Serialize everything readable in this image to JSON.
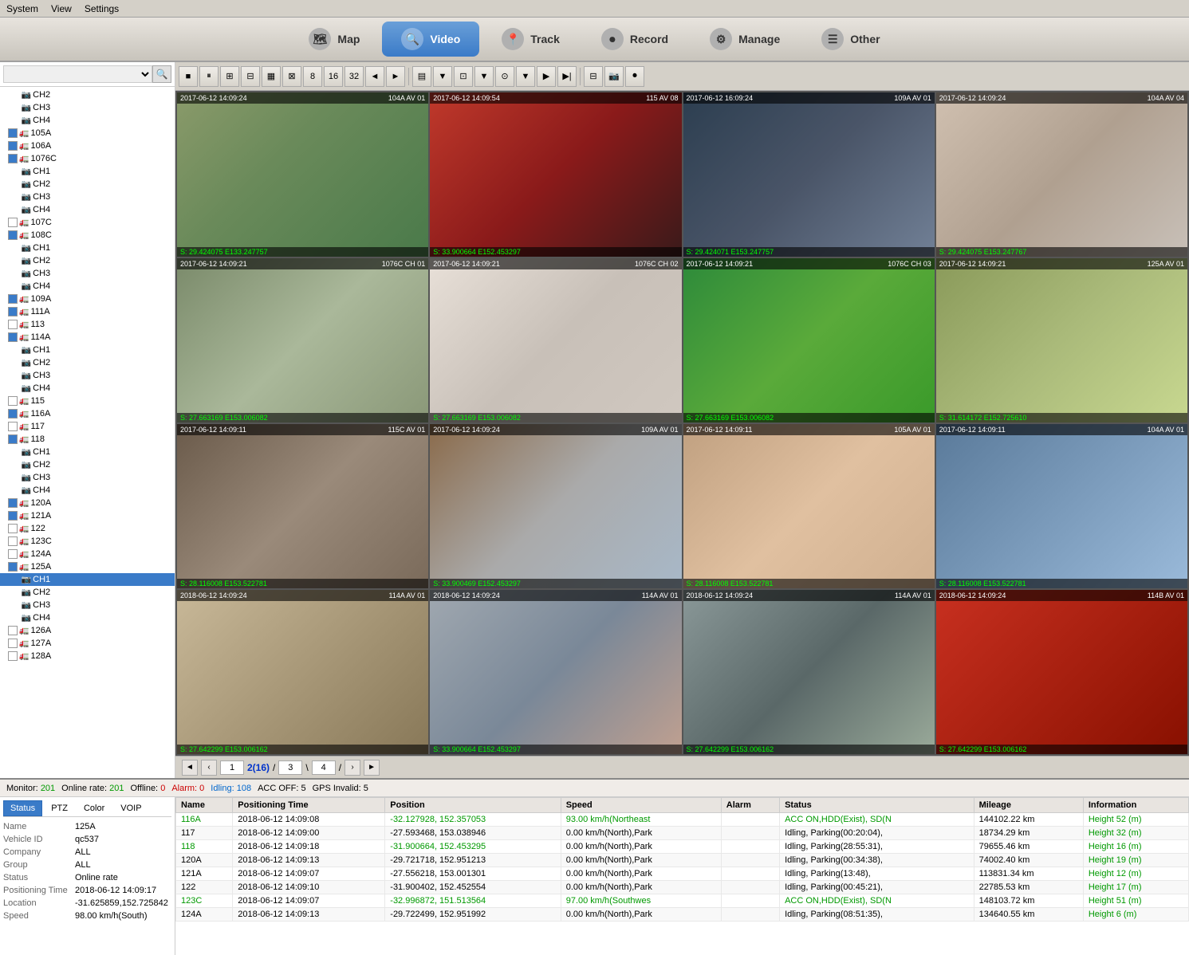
{
  "menu": {
    "system": "System",
    "view": "View",
    "settings": "Settings"
  },
  "nav": {
    "tabs": [
      {
        "id": "map",
        "label": "Map",
        "icon": "🗺",
        "active": false
      },
      {
        "id": "video",
        "label": "Video",
        "icon": "🔍",
        "active": true
      },
      {
        "id": "track",
        "label": "Track",
        "icon": "📍",
        "active": false
      },
      {
        "id": "record",
        "label": "Record",
        "icon": "⏺",
        "active": false
      },
      {
        "id": "manage",
        "label": "Manage",
        "icon": "⚙",
        "active": false
      },
      {
        "id": "other",
        "label": "Other",
        "icon": "☰",
        "active": false
      }
    ]
  },
  "sidebar": {
    "search_placeholder": "Search",
    "tree": [
      {
        "id": "ch2",
        "label": "CH2",
        "level": 2,
        "type": "channel",
        "checked": false
      },
      {
        "id": "ch3",
        "label": "CH3",
        "level": 2,
        "type": "channel",
        "checked": false
      },
      {
        "id": "ch4",
        "label": "CH4",
        "level": 2,
        "type": "channel",
        "checked": false
      },
      {
        "id": "105a",
        "label": "105A",
        "level": 1,
        "type": "vehicle",
        "checked": true
      },
      {
        "id": "106a",
        "label": "106A",
        "level": 1,
        "type": "vehicle",
        "checked": true
      },
      {
        "id": "1076c",
        "label": "1076C",
        "level": 1,
        "type": "vehicle",
        "checked": true,
        "expanded": true
      },
      {
        "id": "1076c-ch1",
        "label": "CH1",
        "level": 2,
        "type": "channel",
        "checked": false
      },
      {
        "id": "1076c-ch2",
        "label": "CH2",
        "level": 2,
        "type": "channel",
        "checked": false
      },
      {
        "id": "1076c-ch3",
        "label": "CH3",
        "level": 2,
        "type": "channel",
        "checked": false
      },
      {
        "id": "1076c-ch4",
        "label": "CH4",
        "level": 2,
        "type": "channel",
        "checked": false
      },
      {
        "id": "107c",
        "label": "107C",
        "level": 1,
        "type": "vehicle",
        "checked": false
      },
      {
        "id": "108c",
        "label": "108C",
        "level": 1,
        "type": "vehicle",
        "checked": true,
        "expanded": true
      },
      {
        "id": "108c-ch1",
        "label": "CH1",
        "level": 2,
        "type": "channel",
        "checked": false
      },
      {
        "id": "108c-ch2",
        "label": "CH2",
        "level": 2,
        "type": "channel",
        "checked": false
      },
      {
        "id": "108c-ch3",
        "label": "CH3",
        "level": 2,
        "type": "channel",
        "checked": false
      },
      {
        "id": "108c-ch4",
        "label": "CH4",
        "level": 2,
        "type": "channel",
        "checked": false
      },
      {
        "id": "109a",
        "label": "109A",
        "level": 1,
        "type": "vehicle",
        "checked": true
      },
      {
        "id": "111a",
        "label": "111A",
        "level": 1,
        "type": "vehicle",
        "checked": true
      },
      {
        "id": "113",
        "label": "113",
        "level": 1,
        "type": "vehicle",
        "checked": false
      },
      {
        "id": "114a",
        "label": "114A",
        "level": 1,
        "type": "vehicle",
        "checked": true,
        "expanded": true
      },
      {
        "id": "114a-ch1",
        "label": "CH1",
        "level": 2,
        "type": "channel",
        "checked": false
      },
      {
        "id": "114a-ch2",
        "label": "CH2",
        "level": 2,
        "type": "channel",
        "checked": false
      },
      {
        "id": "114a-ch3",
        "label": "CH3",
        "level": 2,
        "type": "channel",
        "checked": false
      },
      {
        "id": "114a-ch4",
        "label": "CH4",
        "level": 2,
        "type": "channel",
        "checked": false
      },
      {
        "id": "115",
        "label": "115",
        "level": 1,
        "type": "vehicle",
        "checked": false
      },
      {
        "id": "116a",
        "label": "116A",
        "level": 1,
        "type": "vehicle",
        "checked": true
      },
      {
        "id": "117",
        "label": "117",
        "level": 1,
        "type": "vehicle",
        "checked": false
      },
      {
        "id": "118",
        "label": "118",
        "level": 1,
        "type": "vehicle",
        "checked": true,
        "expanded": true
      },
      {
        "id": "118-ch1",
        "label": "CH1",
        "level": 2,
        "type": "channel",
        "checked": false
      },
      {
        "id": "118-ch2",
        "label": "CH2",
        "level": 2,
        "type": "channel",
        "checked": false
      },
      {
        "id": "118-ch3",
        "label": "CH3",
        "level": 2,
        "type": "channel",
        "checked": false
      },
      {
        "id": "118-ch4",
        "label": "CH4",
        "level": 2,
        "type": "channel",
        "checked": false
      },
      {
        "id": "120a",
        "label": "120A",
        "level": 1,
        "type": "vehicle",
        "checked": true
      },
      {
        "id": "121a",
        "label": "121A",
        "level": 1,
        "type": "vehicle",
        "checked": true
      },
      {
        "id": "122",
        "label": "122",
        "level": 1,
        "type": "vehicle",
        "checked": false
      },
      {
        "id": "123c",
        "label": "123C",
        "level": 1,
        "type": "vehicle",
        "checked": false
      },
      {
        "id": "124a",
        "label": "124A",
        "level": 1,
        "type": "vehicle",
        "checked": false
      },
      {
        "id": "125a",
        "label": "125A",
        "level": 1,
        "type": "vehicle",
        "checked": true,
        "expanded": true
      },
      {
        "id": "125a-ch1",
        "label": "CH1",
        "level": 2,
        "type": "channel",
        "checked": false,
        "selected": true
      },
      {
        "id": "125a-ch2",
        "label": "CH2",
        "level": 2,
        "type": "channel",
        "checked": false
      },
      {
        "id": "125a-ch3",
        "label": "CH3",
        "level": 2,
        "type": "channel",
        "checked": false
      },
      {
        "id": "125a-ch4",
        "label": "CH4",
        "level": 2,
        "type": "channel",
        "checked": false
      },
      {
        "id": "126a",
        "label": "126A",
        "level": 1,
        "type": "vehicle",
        "checked": false
      },
      {
        "id": "127a",
        "label": "127A",
        "level": 1,
        "type": "vehicle",
        "checked": false
      },
      {
        "id": "128a",
        "label": "128A",
        "level": 1,
        "type": "vehicle",
        "checked": false
      }
    ]
  },
  "video_cells": [
    {
      "id": 1,
      "timestamp": "2017-06-12 14:09:24",
      "label": "104A AV 01",
      "coords": "S: 29.424075 E133.247757"
    },
    {
      "id": 2,
      "timestamp": "2017-06-12 14:09:54",
      "label": "115 AV 08",
      "coords": "S: 33.900664 E152.453297"
    },
    {
      "id": 3,
      "timestamp": "2017-06-12 16:09:24",
      "label": "109A AV 01",
      "coords": "S: 29.424071 E153.247757"
    },
    {
      "id": 4,
      "timestamp": "2017-06-12 14:09:24",
      "label": "104A AV 04",
      "coords": "S: 29.424075 E153.247767"
    },
    {
      "id": 5,
      "timestamp": "2017-06-12 14:09:21",
      "label": "1076C CH 01",
      "coords": "S: 27.663169 E153.006082"
    },
    {
      "id": 6,
      "timestamp": "2017-06-12 14:09:21",
      "label": "1076C CH 02",
      "coords": "S: 27.663169 E153.006082"
    },
    {
      "id": 7,
      "timestamp": "2017-06-12 14:09:21",
      "label": "1076C CH 03",
      "coords": "S: 27.663169 E153.006082"
    },
    {
      "id": 8,
      "timestamp": "2017-06-12 14:09:21",
      "label": "125A AV 01",
      "coords": "S: 31.614172 E152.725610"
    },
    {
      "id": 9,
      "timestamp": "2017-06-12 14:09:11",
      "label": "115C AV 01",
      "coords": "S: 28.116008 E153.522781"
    },
    {
      "id": 10,
      "timestamp": "2017-06-12 14:09:24",
      "label": "109A AV 01",
      "coords": "S: 33.900469 E152.453297"
    },
    {
      "id": 11,
      "timestamp": "2017-06-12 14:09:11",
      "label": "105A AV 01",
      "coords": "S: 28.116008 E153.522781"
    },
    {
      "id": 12,
      "timestamp": "2017-06-12 14:09:11",
      "label": "104A AV 01",
      "coords": "S: 28.116008 E153.522781"
    },
    {
      "id": 13,
      "timestamp": "2018-06-12 14:09:24",
      "label": "114A AV 01",
      "coords": "S: 27.642299 E153.006162"
    },
    {
      "id": 14,
      "timestamp": "2018-06-12 14:09:24",
      "label": "114A AV 01",
      "coords": "S: 33.900664 E152.453297"
    },
    {
      "id": 15,
      "timestamp": "2018-06-12 14:09:24",
      "label": "114A AV 01",
      "coords": "S: 27.642299 E153.006162"
    },
    {
      "id": 16,
      "timestamp": "2018-06-12 14:09:24",
      "label": "114B AV 01",
      "coords": "S: 27.642299 E153.006162"
    }
  ],
  "pagination": {
    "prev_label": "◄",
    "next_label": "►",
    "first_label": "◄◄",
    "last_label": "►►",
    "current_page": "2",
    "total_pages": "16",
    "page_label": "2(16)",
    "jump_to": "3",
    "end_page": "4"
  },
  "status_bar": {
    "monitor_label": "Monitor:",
    "monitor_value": "201",
    "online_label": "Online rate:",
    "online_value": "201",
    "offline_label": "Offline:",
    "offline_value": "0",
    "alarm_label": "Alarm:",
    "alarm_value": "0",
    "idling_label": "Idling:",
    "idling_value": "108",
    "acc_off_label": "ACC OFF:",
    "acc_off_value": "5",
    "gps_invalid_label": "GPS Invalid:",
    "gps_invalid_value": "5"
  },
  "info_tabs": [
    "Status",
    "PTZ",
    "Color",
    "VOIP"
  ],
  "info_panel": {
    "name_label": "Name",
    "name_value": "125A",
    "vehicle_id_label": "Vehicle ID",
    "vehicle_id_value": "qc537",
    "company_label": "Company",
    "company_value": "ALL",
    "group_label": "Group",
    "group_value": "ALL",
    "status_label": "Status",
    "status_value": "Online rate",
    "pos_time_label": "Positioning Time",
    "pos_time_value": "2018-06-12 14:09:17",
    "location_label": "Location",
    "location_value": "-31.625859,152.725842",
    "speed_label": "Speed",
    "speed_value": "98.00 km/h(South)"
  },
  "table": {
    "columns": [
      "Name",
      "Positioning Time",
      "Position",
      "Speed",
      "Alarm",
      "Status",
      "Mileage",
      "Information"
    ],
    "rows": [
      {
        "name": "116A",
        "name_color": "green",
        "time": "2018-06-12 14:09:08",
        "position": "-32.127928, 152.357053",
        "position_color": "green",
        "speed": "93.00 km/h(Northeast",
        "speed_color": "green",
        "alarm": "",
        "status": "ACC ON,HDD(Exist), SD(N",
        "status_color": "green",
        "mileage": "144102.22 km",
        "info": "Height 52 (m)",
        "info_color": "green"
      },
      {
        "name": "117",
        "name_color": "black",
        "time": "2018-06-12 14:09:00",
        "position": "-27.593468, 153.038946",
        "position_color": "black",
        "speed": "0.00 km/h(North),Park",
        "speed_color": "black",
        "alarm": "",
        "status": "Idling, Parking(00:20:04),",
        "status_color": "black",
        "mileage": "18734.29 km",
        "info": "Height 32 (m)",
        "info_color": "green"
      },
      {
        "name": "118",
        "name_color": "green",
        "time": "2018-06-12 14:09:18",
        "position": "-31.900664, 152.453295",
        "position_color": "green",
        "speed": "0.00 km/h(North),Park",
        "speed_color": "black",
        "alarm": "",
        "status": "Idling, Parking(28:55:31),",
        "status_color": "black",
        "mileage": "79655.46 km",
        "info": "Height 16 (m)",
        "info_color": "green"
      },
      {
        "name": "120A",
        "name_color": "black",
        "time": "2018-06-12 14:09:13",
        "position": "-29.721718, 152.951213",
        "position_color": "black",
        "speed": "0.00 km/h(North),Park",
        "speed_color": "black",
        "alarm": "",
        "status": "Idling, Parking(00:34:38),",
        "status_color": "black",
        "mileage": "74002.40 km",
        "info": "Height 19 (m)",
        "info_color": "green"
      },
      {
        "name": "121A",
        "name_color": "black",
        "time": "2018-06-12 14:09:07",
        "position": "-27.556218, 153.001301",
        "position_color": "black",
        "speed": "0.00 km/h(North),Park",
        "speed_color": "black",
        "alarm": "",
        "status": "Idling, Parking(13:48),",
        "status_color": "black",
        "mileage": "113831.34 km",
        "info": "Height 12 (m)",
        "info_color": "green"
      },
      {
        "name": "122",
        "name_color": "black",
        "time": "2018-06-12 14:09:10",
        "position": "-31.900402, 152.452554",
        "position_color": "black",
        "speed": "0.00 km/h(North),Park",
        "speed_color": "black",
        "alarm": "",
        "status": "Idling, Parking(00:45:21),",
        "status_color": "black",
        "mileage": "22785.53 km",
        "info": "Height 17 (m)",
        "info_color": "green"
      },
      {
        "name": "123C",
        "name_color": "green",
        "time": "2018-06-12 14:09:07",
        "position": "-32.996872, 151.513564",
        "position_color": "green",
        "speed": "97.00 km/h(Southwes",
        "speed_color": "green",
        "alarm": "",
        "status": "ACC ON,HDD(Exist), SD(N",
        "status_color": "green",
        "mileage": "148103.72 km",
        "info": "Height 51 (m)",
        "info_color": "green"
      },
      {
        "name": "124A",
        "name_color": "black",
        "time": "2018-06-12 14:09:13",
        "position": "-29.722499, 152.951992",
        "position_color": "black",
        "speed": "0.00 km/h(North),Park",
        "speed_color": "black",
        "alarm": "",
        "status": "Idling, Parking(08:51:35),",
        "status_color": "black",
        "mileage": "134640.55 km",
        "info": "Height 6 (m)",
        "info_color": "green"
      }
    ]
  }
}
